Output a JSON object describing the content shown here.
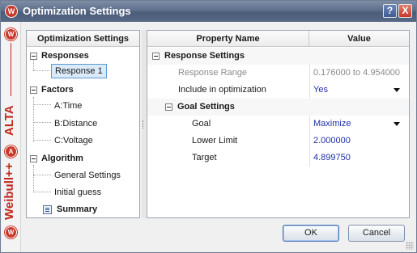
{
  "window": {
    "title": "Optimization Settings",
    "help_label": "?",
    "close_label": "X"
  },
  "brand": {
    "logo_letter": "W",
    "product_top": "ALTA",
    "product_bottom": "Weibull++",
    "alta_logo_letter": "A"
  },
  "tree": {
    "header": "Optimization Settings",
    "groups": {
      "responses": "Responses",
      "factors": "Factors",
      "algorithm": "Algorithm",
      "summary": "Summary"
    },
    "items": {
      "response1": "Response 1",
      "time": "A:Time",
      "distance": "B:Distance",
      "voltage": "C:Voltage",
      "general": "General Settings",
      "guess": "Initial guess"
    }
  },
  "grid": {
    "col_property": "Property Name",
    "col_value": "Value",
    "response_settings": "Response Settings",
    "goal_settings": "Goal Settings",
    "rows": {
      "range_label": "Response Range",
      "range_value": "0.176000 to 4.954000",
      "include_label": "Include in optimization",
      "include_value": "Yes",
      "goal_label": "Goal",
      "goal_value": "Maximize",
      "lower_label": "Lower Limit",
      "lower_value": "2.000000",
      "target_label": "Target",
      "target_value": "4.899750"
    }
  },
  "buttons": {
    "ok": "OK",
    "cancel": "Cancel"
  }
}
